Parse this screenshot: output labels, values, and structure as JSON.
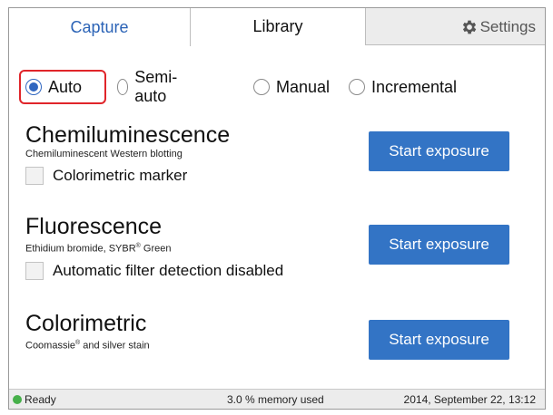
{
  "tabs": {
    "capture": "Capture",
    "library": "Library",
    "settings": "Settings"
  },
  "modes": [
    {
      "label": "Auto",
      "checked": true
    },
    {
      "label": "Semi-auto",
      "checked": false
    },
    {
      "label": "Manual",
      "checked": false
    },
    {
      "label": "Incremental",
      "checked": false
    }
  ],
  "sections": {
    "chemi": {
      "title": "Chemiluminescence",
      "subtitle": "Chemiluminescent Western blotting",
      "checkbox_label": "Colorimetric marker",
      "button": "Start exposure"
    },
    "fluor": {
      "title": "Fluorescence",
      "subtitle_pre": "Ethidium bromide, SYBR",
      "subtitle_sup": "®",
      "subtitle_post": " Green",
      "checkbox_label": "Automatic filter detection disabled",
      "button": "Start exposure"
    },
    "color": {
      "title": "Colorimetric",
      "subtitle_pre": "Coomassie",
      "subtitle_sup": "®",
      "subtitle_post": " and silver stain",
      "button": "Start exposure"
    }
  },
  "status": {
    "ready": "Ready",
    "memory": "3.0 % memory used",
    "datetime": "2014, September 22, 13:12"
  },
  "colors": {
    "accent": "#3374c5",
    "highlight": "#e0252a",
    "ready_led": "#46b04a"
  },
  "icons": {
    "settings": "gear-icon",
    "ready": "status-led-icon"
  }
}
